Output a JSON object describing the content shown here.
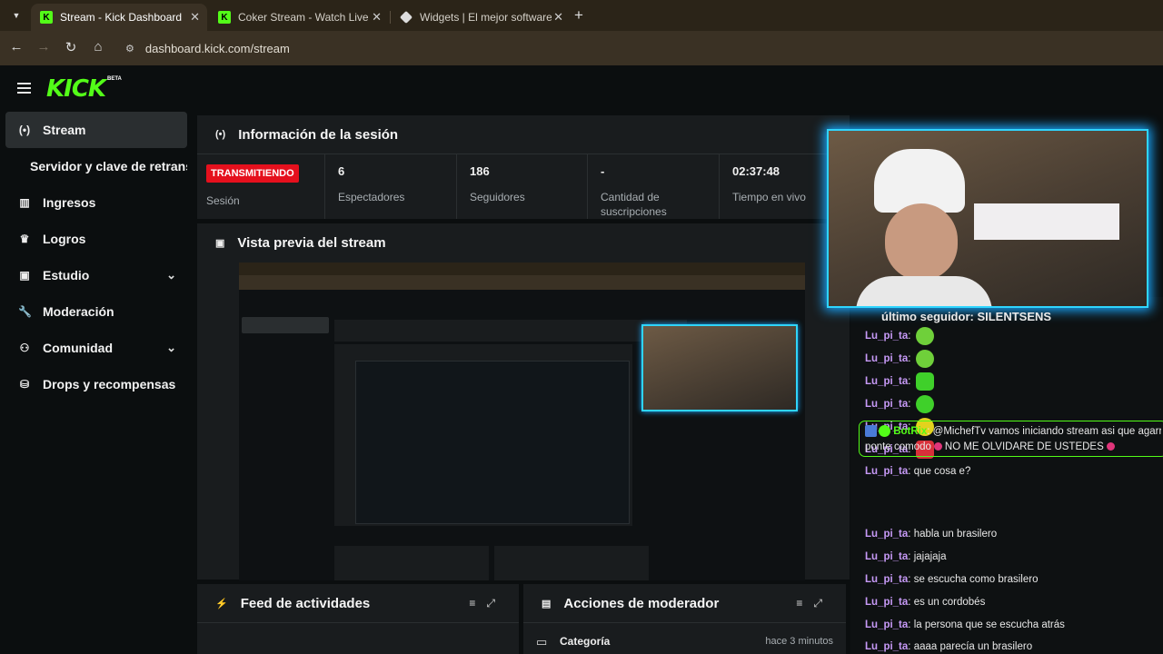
{
  "browser": {
    "tabs": [
      {
        "title": "Stream - Kick Dashboard",
        "favicon": "kick-logo-icon",
        "active": true
      },
      {
        "title": "Coker Stream - Watch Live on K",
        "favicon": "kick-logo-icon",
        "active": false
      },
      {
        "title": "Widgets | El mejor software par",
        "favicon": "widgets-diamond-icon",
        "active": false
      }
    ],
    "url": "dashboard.kick.com/stream"
  },
  "app": {
    "logo": "KICK",
    "logo_badge": "BETA"
  },
  "sidebar": {
    "items": [
      {
        "label": "Stream",
        "icon": "broadcast-icon",
        "active": true
      },
      {
        "label": "Servidor y clave de retransmisión",
        "icon": "",
        "sub": true
      },
      {
        "label": "Ingresos",
        "icon": "chart-icon"
      },
      {
        "label": "Logros",
        "icon": "trophy-icon"
      },
      {
        "label": "Estudio",
        "icon": "studio-icon",
        "expandable": true
      },
      {
        "label": "Moderación",
        "icon": "wrench-icon"
      },
      {
        "label": "Comunidad",
        "icon": "people-icon",
        "expandable": true
      },
      {
        "label": "Drops y recompensas",
        "icon": "gift-icon"
      }
    ]
  },
  "session": {
    "title": "Información de la sesión",
    "badge": "TRANSMITIENDO",
    "badge_label": "Sesión",
    "stats": [
      {
        "value": "6",
        "label": "Espectadores"
      },
      {
        "value": "186",
        "label": "Seguidores"
      },
      {
        "value": "-",
        "label": "Cantidad de suscripciones"
      },
      {
        "value": "02:37:48",
        "label": "Tiempo en vivo"
      }
    ]
  },
  "preview": {
    "title": "Vista previa del stream"
  },
  "feed": {
    "title": "Feed de actividades"
  },
  "modactions": {
    "title": "Acciones de moderador",
    "category_label": "Categoría",
    "category_time": "hace 3 minutos"
  },
  "overlay": {
    "follower_text": "último seguidor: SILENTSENS"
  },
  "chat": {
    "messages": [
      {
        "user": "Lu_pi_ta",
        "text": "",
        "emote": "green-monster-emote"
      },
      {
        "user": "Lu_pi_ta",
        "text": "",
        "emote": "green-monster-emote"
      },
      {
        "user": "Lu_pi_ta",
        "text": "",
        "emote": "green-blob-emote"
      },
      {
        "user": "Lu_pi_ta",
        "text": "",
        "emote": "green-grin-emote"
      },
      {
        "user": "Lu_pi_ta",
        "text": "",
        "emote": "yellow-face-emote"
      },
      {
        "user": "Lu_pi_ta",
        "text": "",
        "emote": "red-face-emote"
      },
      {
        "user": "Lu_pi_ta",
        "text": "que cosa e?"
      },
      {
        "user": "Lu_pi_ta",
        "text": "habla un brasilero"
      },
      {
        "user": "Lu_pi_ta",
        "text": "jajajaja"
      },
      {
        "user": "Lu_pi_ta",
        "text": "se escucha como brasilero"
      },
      {
        "user": "Lu_pi_ta",
        "text": "es un cordobés"
      },
      {
        "user": "Lu_pi_ta",
        "text": "la persona que se escucha atrás"
      },
      {
        "user": "Lu_pi_ta",
        "text": "aaaa parecía un brasilero"
      }
    ],
    "bot": {
      "user": "BotRix",
      "line1": "@MichefTv vamos iniciando stream asi que agarr",
      "line2_a": "ponte comodo",
      "line2_b": "NO ME OLVIDARE DE USTEDES"
    }
  }
}
